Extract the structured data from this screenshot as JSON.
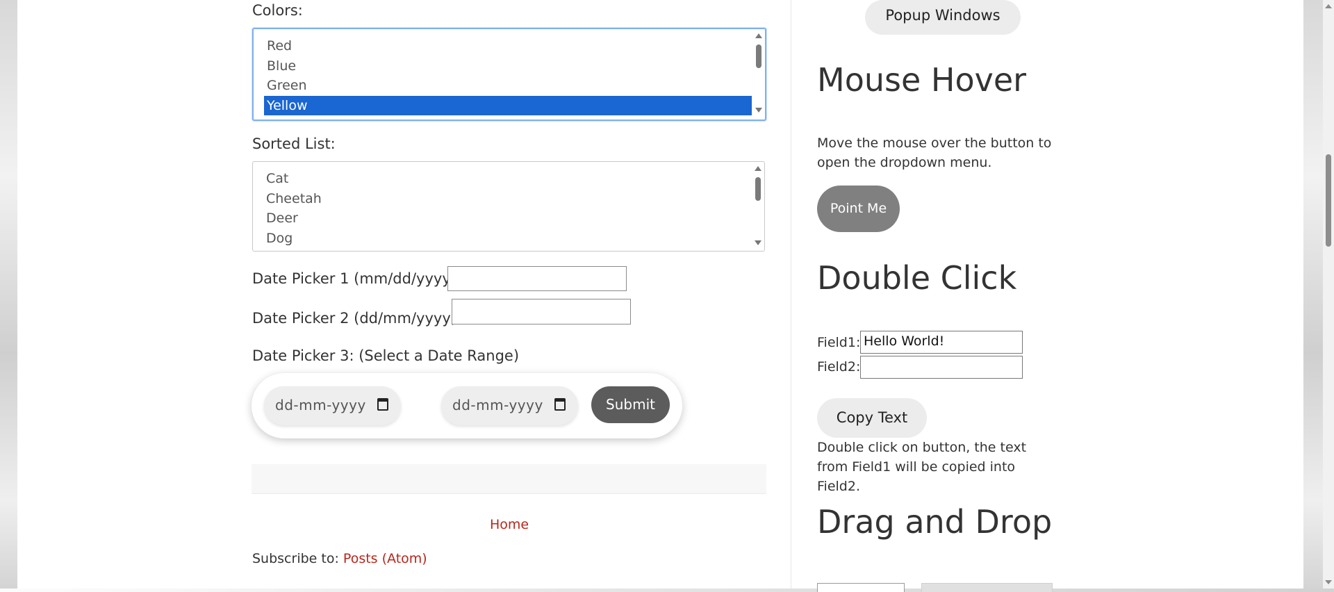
{
  "left": {
    "colors": {
      "label": "Colors:",
      "options": [
        "Red",
        "Blue",
        "Green",
        "Yellow"
      ],
      "selected": "Yellow"
    },
    "sorted": {
      "label": "Sorted List:",
      "options": [
        "Cat",
        "Cheetah",
        "Deer",
        "Dog"
      ]
    },
    "datepicker1": {
      "label": "Date Picker 1 (mm/dd/yyyy):",
      "value": ""
    },
    "datepicker2": {
      "label": "Date Picker 2 (dd/mm/yyyy) :",
      "value": ""
    },
    "datepicker3": {
      "label": "Date Picker 3: (Select a Date Range)",
      "start_placeholder": "dd-mm-yyyy",
      "end_placeholder": "dd-mm-yyyy",
      "submit_label": "Submit"
    },
    "footer": {
      "home_link": "Home",
      "subscribe_prefix": "Subscribe to:",
      "subscribe_link": "Posts (Atom)"
    }
  },
  "right": {
    "popup_button": "Popup Windows",
    "mouse_hover": {
      "heading": "Mouse Hover",
      "text": "Move the mouse over the button to open the dropdown menu.",
      "button": "Point Me"
    },
    "double_click": {
      "heading": "Double Click",
      "field1_label": "Field1:",
      "field1_value": "Hello World!",
      "field2_label": "Field2:",
      "field2_value": "",
      "button": "Copy Text",
      "text": "Double click on button, the text from Field1 will be copied into Field2."
    },
    "drag_drop": {
      "heading": "Drag and Drop"
    }
  },
  "colors": {
    "selected_option_bg": "#1a66d2",
    "link": "#b8261a",
    "dark_button": "#5c5c5c",
    "hover_button": "#808080"
  }
}
